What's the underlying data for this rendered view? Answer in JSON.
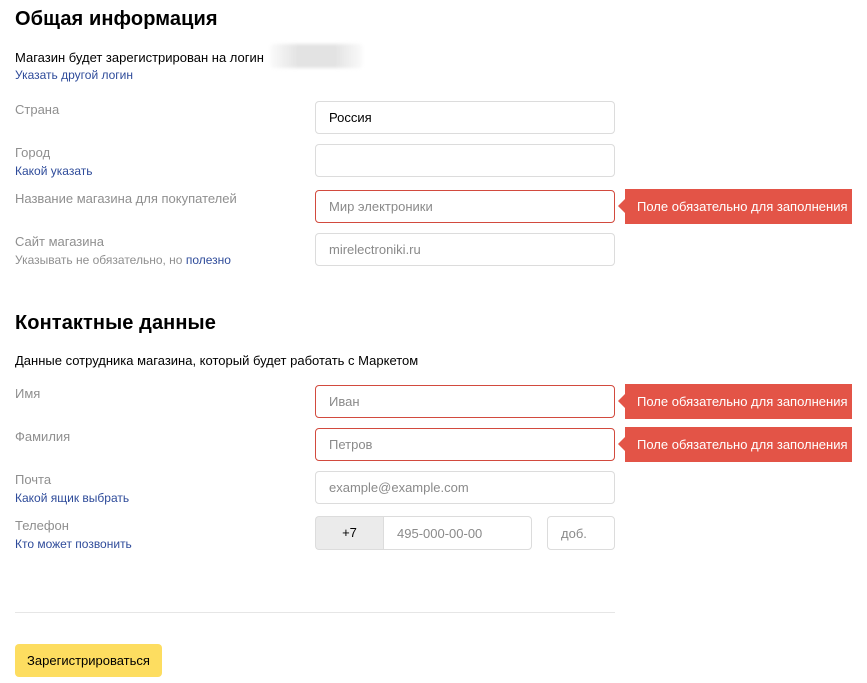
{
  "general": {
    "title": "Общая информация",
    "login_text": "Магазин будет зарегистрирован на логин",
    "change_login_link": "Указать другой логин",
    "country_label": "Страна",
    "country_value": "Россия",
    "city_label": "Город",
    "city_hint_link": "Какой указать",
    "city_value": "",
    "shop_name_label": "Название магазина для покупателей",
    "shop_name_placeholder": "Мир электроники",
    "site_label": "Сайт магазина",
    "site_hint_text": "Указывать не обязательно, но",
    "site_hint_link": "полезно",
    "site_placeholder": "mirelectroniki.ru"
  },
  "contacts": {
    "title": "Контактные данные",
    "description": "Данные сотрудника магазина, который будет работать с Маркетом",
    "first_name_label": "Имя",
    "first_name_placeholder": "Иван",
    "last_name_label": "Фамилия",
    "last_name_placeholder": "Петров",
    "email_label": "Почта",
    "email_hint_link": "Какой ящик выбрать",
    "email_placeholder": "example@example.com",
    "phone_label": "Телефон",
    "phone_hint_link": "Кто может позвонить",
    "phone_code": "+7",
    "phone_placeholder": "495-000-00-00",
    "phone_ext_placeholder": "доб."
  },
  "errors": {
    "required": "Поле обязательно для заполнения"
  },
  "submit_label": "Зарегистрироваться",
  "colors": {
    "error": "#e35447",
    "link": "#2e4b9a",
    "button": "#fddd60"
  }
}
